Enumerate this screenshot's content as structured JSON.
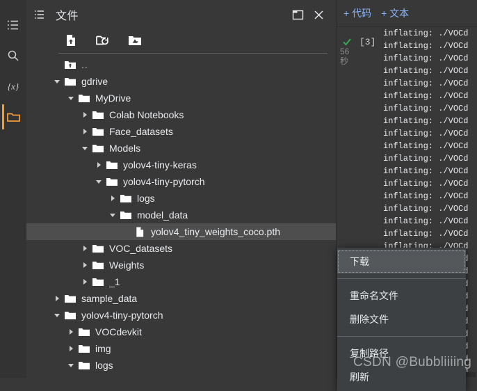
{
  "rail": {
    "items": [
      {
        "name": "table-of-contents",
        "icon": "list-icon",
        "active": false
      },
      {
        "name": "search",
        "icon": "search-icon",
        "active": false
      },
      {
        "name": "variables",
        "icon": "variables-icon",
        "active": false
      },
      {
        "name": "files",
        "icon": "folder-icon",
        "active": true
      }
    ],
    "accent_color": "#f29b38"
  },
  "files_panel": {
    "title": "文件",
    "list_icon": "list-icon",
    "window_buttons": [
      {
        "label": "",
        "icon": "dock-panel-icon"
      },
      {
        "label": "",
        "icon": "close-icon"
      }
    ],
    "toolbar": [
      {
        "icon": "upload-file-icon",
        "tooltip": "上传"
      },
      {
        "icon": "refresh-folder-icon",
        "tooltip": "刷新"
      },
      {
        "icon": "mount-drive-icon",
        "tooltip": "装载 Google 云端硬盘"
      }
    ],
    "tree": [
      {
        "label": "..",
        "depth": 0,
        "type": "up",
        "state": "none",
        "selected": false
      },
      {
        "label": "gdrive",
        "depth": 0,
        "type": "folder",
        "state": "expanded",
        "selected": false
      },
      {
        "label": "MyDrive",
        "depth": 1,
        "type": "folder",
        "state": "expanded",
        "selected": false
      },
      {
        "label": "Colab Notebooks",
        "depth": 2,
        "type": "folder",
        "state": "collapsed",
        "selected": false
      },
      {
        "label": "Face_datasets",
        "depth": 2,
        "type": "folder",
        "state": "collapsed",
        "selected": false
      },
      {
        "label": "Models",
        "depth": 2,
        "type": "folder",
        "state": "expanded",
        "selected": false
      },
      {
        "label": "yolov4-tiny-keras",
        "depth": 3,
        "type": "folder",
        "state": "collapsed",
        "selected": false
      },
      {
        "label": "yolov4-tiny-pytorch",
        "depth": 3,
        "type": "folder",
        "state": "expanded",
        "selected": false
      },
      {
        "label": "logs",
        "depth": 4,
        "type": "folder",
        "state": "collapsed",
        "selected": false
      },
      {
        "label": "model_data",
        "depth": 4,
        "type": "folder",
        "state": "expanded",
        "selected": false
      },
      {
        "label": "yolov4_tiny_weights_coco.pth",
        "depth": 5,
        "type": "file",
        "state": "none",
        "selected": true
      },
      {
        "label": "VOC_datasets",
        "depth": 2,
        "type": "folder",
        "state": "collapsed",
        "selected": false
      },
      {
        "label": "Weights",
        "depth": 2,
        "type": "folder",
        "state": "collapsed",
        "selected": false
      },
      {
        "label": "_1",
        "depth": 2,
        "type": "folder",
        "state": "collapsed",
        "selected": false
      },
      {
        "label": "sample_data",
        "depth": 0,
        "type": "folder",
        "state": "collapsed",
        "selected": false
      },
      {
        "label": "yolov4-tiny-pytorch",
        "depth": 0,
        "type": "folder",
        "state": "expanded",
        "selected": false
      },
      {
        "label": "VOCdevkit",
        "depth": 1,
        "type": "folder",
        "state": "collapsed",
        "selected": false
      },
      {
        "label": "img",
        "depth": 1,
        "type": "folder",
        "state": "collapsed",
        "selected": false
      },
      {
        "label": "logs",
        "depth": 1,
        "type": "folder",
        "state": "expanded",
        "selected": false
      }
    ]
  },
  "notebook": {
    "add_code_label": "+ 代码",
    "add_text_label": "+ 文本",
    "link_color": "#8ab4f8",
    "cell": {
      "status_icon": "green-check-icon",
      "status_color": "#34a853",
      "run_time": "56\n秒",
      "run_time_number": "56",
      "run_time_unit": "秒",
      "execution_count": "[3]",
      "output_lines": [
        "inflating: ./VOCd",
        "inflating: ./VOCd",
        "inflating: ./VOCd",
        "inflating: ./VOCd",
        "inflating: ./VOCd",
        "inflating: ./VOCd",
        "inflating: ./VOCd",
        "inflating: ./VOCd",
        "inflating: ./VOCd",
        "inflating: ./VOCd",
        "inflating: ./VOCd",
        "inflating: ./VOCd",
        "inflating: ./VOCd",
        "inflating: ./VOCd",
        "inflating: ./VOCd",
        "inflating: ./VOCd",
        "inflating: ./VOCd",
        "inflating: ./VOCd",
        "inflating: ./VOCd",
        "inflating: ./VOCd",
        "inflating: ./VOCd",
        "inflating: ./VOCd",
        "inflating: ./VOCd",
        "inflating: ./VOCd",
        "inflating: ./VOCd",
        "inflating: ./VOCd",
        "inflating: ./VOCd",
        "inflating: ./VOCd"
      ]
    }
  },
  "context_menu": {
    "groups": [
      {
        "items": [
          {
            "label": "下载",
            "highlight": true
          }
        ]
      },
      {
        "items": [
          {
            "label": "重命名文件",
            "highlight": false
          },
          {
            "label": "删除文件",
            "highlight": false
          }
        ]
      },
      {
        "items": [
          {
            "label": "复制路径",
            "highlight": false
          },
          {
            "label": "刷新",
            "highlight": false
          }
        ]
      }
    ]
  },
  "watermark": {
    "text": "CSDN @Bubbliiiing"
  }
}
